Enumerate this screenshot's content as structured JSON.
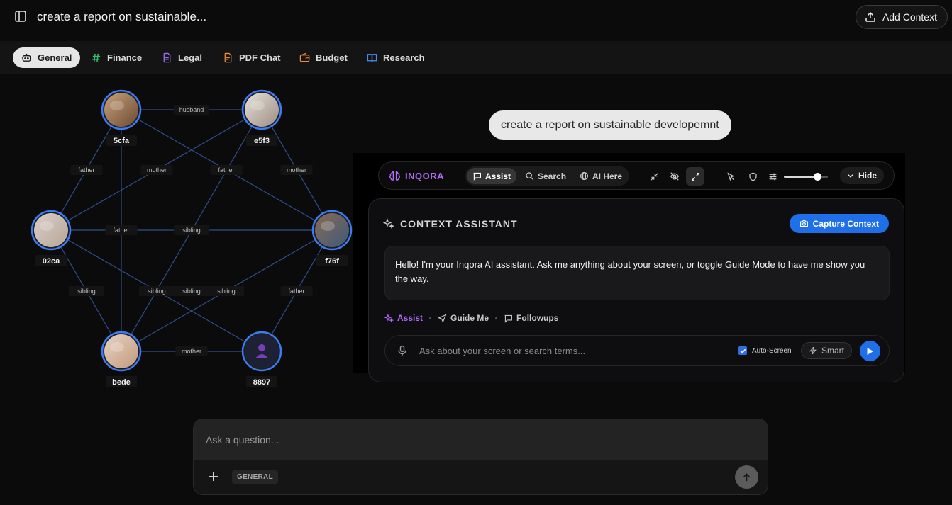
{
  "header": {
    "title": "create a report on sustainable...",
    "add_context_label": "Add Context"
  },
  "tabs": [
    {
      "label": "General",
      "icon": "robot-icon",
      "color": "#1b1b1b"
    },
    {
      "label": "Finance",
      "icon": "hash-icon",
      "color": "#2ec36b"
    },
    {
      "label": "Legal",
      "icon": "document-icon",
      "color": "#a06bf0"
    },
    {
      "label": "PDF Chat",
      "icon": "pdf-file-icon",
      "color": "#f08a3c"
    },
    {
      "label": "Budget",
      "icon": "wallet-icon",
      "color": "#f08a3c"
    },
    {
      "label": "Research",
      "icon": "book-icon",
      "color": "#4a8bf5"
    }
  ],
  "graph": {
    "nodes": [
      {
        "id": "5cfa",
        "label": "5cfa"
      },
      {
        "id": "e5f3",
        "label": "e5f3"
      },
      {
        "id": "02ca",
        "label": "02ca"
      },
      {
        "id": "f76f",
        "label": "f76f"
      },
      {
        "id": "bede",
        "label": "bede"
      },
      {
        "id": "8897",
        "label": "8897"
      }
    ],
    "edges": [
      {
        "from": "5cfa",
        "to": "e5f3",
        "label": "husband"
      },
      {
        "from": "5cfa",
        "to": "02ca",
        "label": "father"
      },
      {
        "from": "e5f3",
        "to": "02ca",
        "label": "mother"
      },
      {
        "from": "5cfa",
        "to": "f76f",
        "label": "father"
      },
      {
        "from": "e5f3",
        "to": "f76f",
        "label": "mother"
      },
      {
        "from": "02ca",
        "to": "f76f",
        "label": "sibling"
      },
      {
        "from": "5cfa",
        "to": "bede",
        "label": "father"
      },
      {
        "from": "02ca",
        "to": "bede",
        "label": "sibling"
      },
      {
        "from": "e5f3",
        "to": "bede",
        "label": "sibling"
      },
      {
        "from": "02ca",
        "to": "8897",
        "label": "sibling"
      },
      {
        "from": "f76f",
        "to": "bede",
        "label": "sibling"
      },
      {
        "from": "f76f",
        "to": "8897",
        "label": "father"
      },
      {
        "from": "bede",
        "to": "8897",
        "label": "mother"
      }
    ]
  },
  "chat": {
    "user_message": "create a report on sustainable developemnt"
  },
  "inqora": {
    "brand": "INQORA",
    "modes": [
      "Assist",
      "Search",
      "AI Here"
    ],
    "active_mode": "Assist",
    "opacity_level": 0.75,
    "hide_label": "Hide",
    "context_title": "CONTEXT ASSISTANT",
    "capture_label": "Capture Context",
    "assistant_message": "Hello! I'm your Inqora AI assistant. Ask me anything about your screen, or toggle Guide Mode to have me show you the way.",
    "submodes": [
      "Assist",
      "Guide Me",
      "Followups"
    ],
    "input_placeholder": "Ask about your screen or search terms...",
    "auto_screen_label": "Auto-Screen",
    "auto_screen_checked": true,
    "smart_label": "Smart",
    "accent": "#b06af5",
    "primary": "#1f6fe8"
  },
  "composer": {
    "placeholder": "Ask a question...",
    "mode_badge": "GENERAL"
  }
}
